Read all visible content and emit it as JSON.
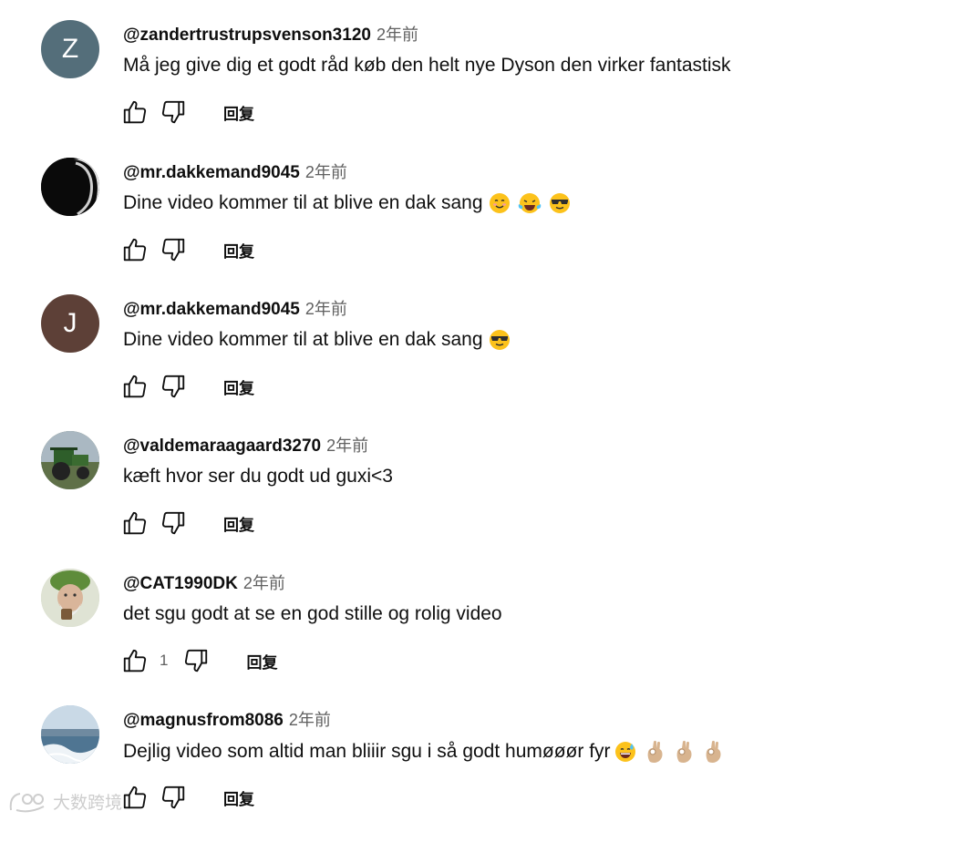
{
  "comments": [
    {
      "author": "@zandertrustrupsvenson3120",
      "time": "2年前",
      "text": "Må jeg give dig et godt råd køb den helt nye Dyson den virker fantastisk",
      "avatar_letter": "Z",
      "avatar_color": "#546e7a",
      "like_count": "",
      "reply_label": "回复",
      "emojis": []
    },
    {
      "author": "@mr.dakkemand9045",
      "time": "2年前",
      "text": "Dine video kommer til at blive en dak sang",
      "avatar_letter": "",
      "avatar_color": "#111111",
      "like_count": "",
      "reply_label": "回复",
      "emojis": [
        "smiling-face",
        "tears-of-joy",
        "sunglasses-face"
      ]
    },
    {
      "author": "@mr.dakkemand9045",
      "time": "2年前",
      "text": "Dine video kommer til at blive en dak sang",
      "avatar_letter": "J",
      "avatar_color": "#5d4037",
      "like_count": "",
      "reply_label": "回复",
      "emojis": [
        "sunglasses-face"
      ]
    },
    {
      "author": "@valdemaraagaard3270",
      "time": "2年前",
      "text": "kæft hvor ser du godt ud guxi<3",
      "avatar_letter": "",
      "avatar_color": "#6b7a5a",
      "like_count": "",
      "reply_label": "回复",
      "emojis": []
    },
    {
      "author": "@CAT1990DK",
      "time": "2年前",
      "text": "det sgu godt at se en god stille og rolig video",
      "avatar_letter": "",
      "avatar_color": "#c9d1b8",
      "like_count": "1",
      "reply_label": "回复",
      "emojis": []
    },
    {
      "author": "@magnusfrom8086",
      "time": "2年前",
      "text": "Dejlig video som altid man bliiir sgu i så godt humøøør fyr",
      "avatar_letter": "",
      "avatar_color": "#8fb3cf",
      "like_count": "",
      "reply_label": "回复",
      "emojis": [
        "grinning-sweat-face",
        "ok-hand",
        "ok-hand",
        "ok-hand"
      ]
    }
  ],
  "watermark": {
    "text": "大数跨境"
  }
}
